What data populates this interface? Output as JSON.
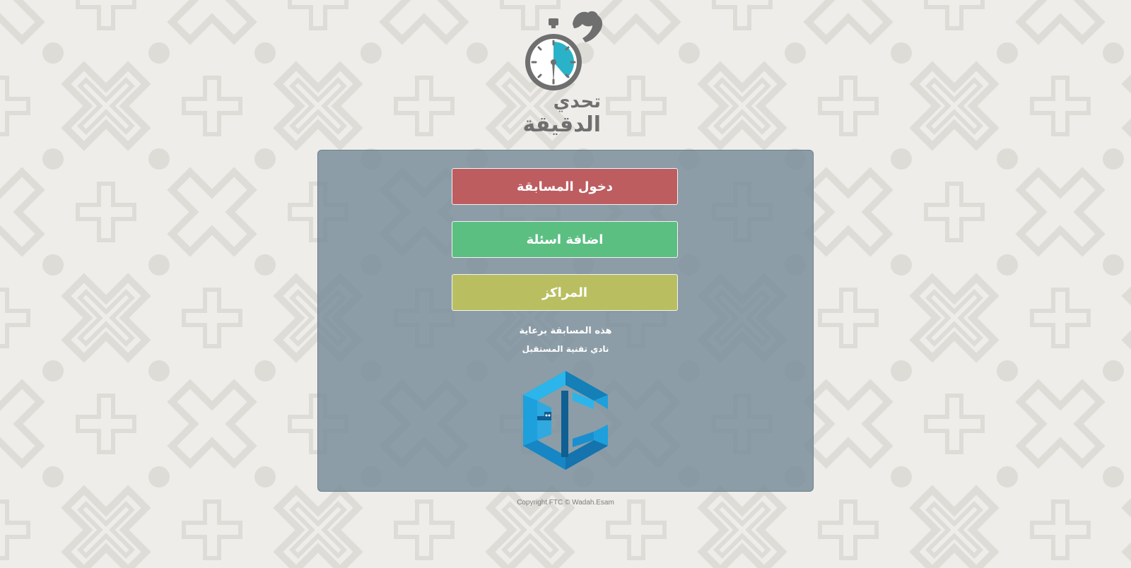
{
  "logo": {
    "line1": "تحدي",
    "line2": "الدقيقة",
    "icon": "stopwatch-muscle-icon"
  },
  "menu": {
    "enter_label": "دخول المسابقة",
    "add_label": "اضافة اسئلة",
    "centers_label": "المراكز"
  },
  "sponsor": {
    "line1": "هذه المسابقة برعاية",
    "line2": "نادي تقنية المستقبل",
    "logo_icon": "ftc-logo"
  },
  "footer": {
    "copyright": "Copyright FTC © Wadah.Esam"
  },
  "colors": {
    "background": "#eeede9",
    "pattern": "#dedcd7",
    "panel": "#7a8f9b",
    "enter": "#bd5d60",
    "add": "#5bbf82",
    "centers": "#b9bf61",
    "logo_accent": "#2ab3c8",
    "logo_gray": "#6f6f6f"
  }
}
